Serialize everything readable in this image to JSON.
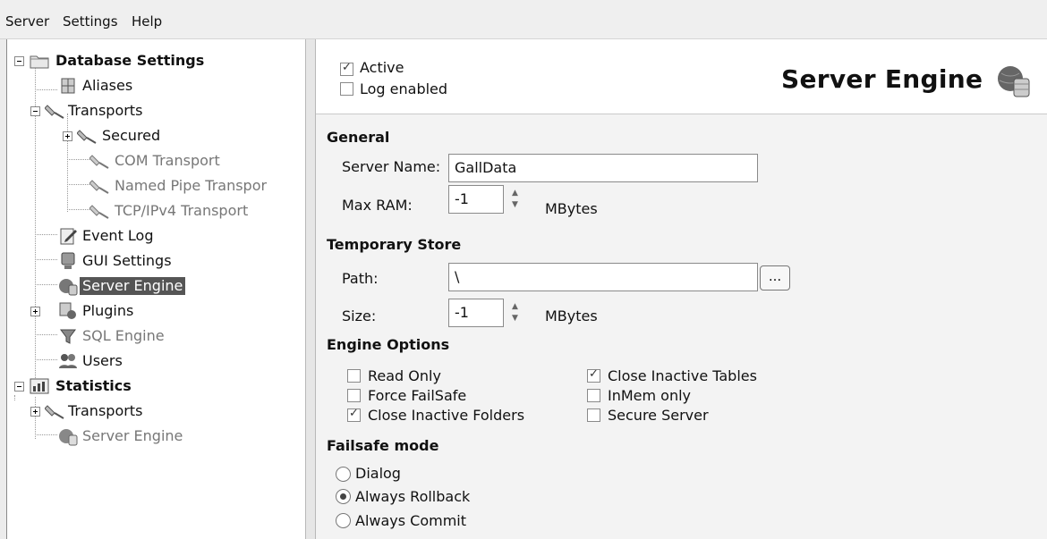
{
  "menu": [
    "Server",
    "Settings",
    "Help"
  ],
  "tree": {
    "database_settings": "Database Settings",
    "aliases": "Aliases",
    "transports": "Transports",
    "secured": "Secured",
    "com_transport": "COM Transport",
    "named_pipe_transport": "Named Pipe Transpor",
    "tcpip_transport": "TCP/IPv4 Transport",
    "event_log": "Event Log",
    "gui_settings": "GUI Settings",
    "server_engine": "Server Engine",
    "plugins": "Plugins",
    "sql_engine": "SQL Engine",
    "users": "Users",
    "statistics": "Statistics",
    "stat_transports": "Transports",
    "stat_server_engine": "Server Engine"
  },
  "header": {
    "title": "Server Engine",
    "active_label": "Active",
    "active_checked": true,
    "log_label": "Log enabled",
    "log_checked": false
  },
  "general": {
    "section": "General",
    "server_name_label": "Server Name:",
    "server_name_value": "GallData",
    "max_ram_label": "Max RAM:",
    "max_ram_value": "-1",
    "max_ram_unit": "MBytes"
  },
  "temporary_store": {
    "section": "Temporary Store",
    "path_label": "Path:",
    "path_value": "\\",
    "browse_label": "...",
    "size_label": "Size:",
    "size_value": "-1",
    "size_unit": "MBytes"
  },
  "engine_options": {
    "section": "Engine Options",
    "read_only": "Read Only",
    "force_failsafe": "Force FailSafe",
    "close_inactive_folders": "Close Inactive Folders",
    "close_inactive_tables": "Close Inactive Tables",
    "inmem_only": "InMem only",
    "secure_server": "Secure Server"
  },
  "failsafe": {
    "section": "Failsafe mode",
    "dialog": "Dialog",
    "always_rollback": "Always Rollback",
    "always_commit": "Always Commit",
    "selected": "Always Rollback"
  }
}
